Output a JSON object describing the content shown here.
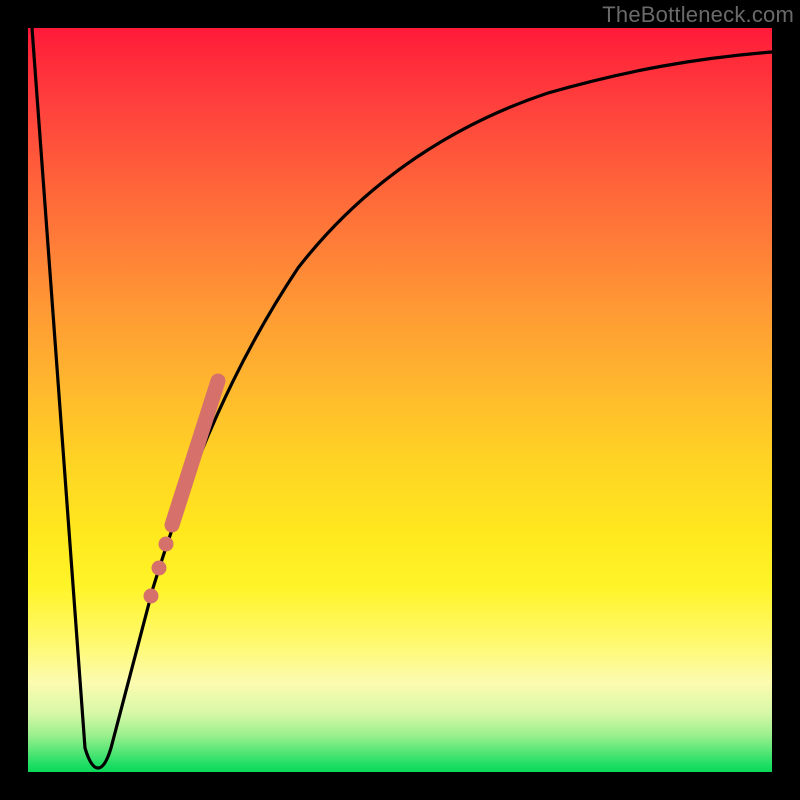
{
  "watermark": "TheBottleneck.com",
  "colors": {
    "frame": "#000000",
    "curve": "#000000",
    "markers": "#d6706a",
    "gradient_top": "#ff1a3a",
    "gradient_bottom": "#0bd95a"
  },
  "chart_data": {
    "type": "line",
    "title": "",
    "xlabel": "",
    "ylabel": "",
    "xlim": [
      0,
      100
    ],
    "ylim": [
      0,
      100
    ],
    "grid": false,
    "legend": false,
    "annotations": [
      "TheBottleneck.com"
    ],
    "series": [
      {
        "name": "bottleneck-curve",
        "x": [
          0,
          2,
          4,
          6,
          7,
          8,
          9,
          10,
          11,
          12,
          14,
          16,
          18,
          20,
          22,
          24,
          27,
          30,
          34,
          38,
          42,
          48,
          55,
          62,
          70,
          78,
          86,
          94,
          100
        ],
        "y": [
          100,
          78,
          55,
          32,
          16,
          3,
          1,
          1,
          3,
          10,
          22,
          32,
          40,
          47,
          52,
          57,
          62,
          67,
          72,
          76,
          80,
          84,
          87,
          89,
          91,
          92,
          93,
          94,
          94.5
        ]
      }
    ],
    "markers": {
      "name": "highlighted-range",
      "style": "thick-dots",
      "points": [
        {
          "x": 16.2,
          "y": 23.0
        },
        {
          "x": 17.3,
          "y": 27.5
        },
        {
          "x": 18.0,
          "y": 30.5
        },
        {
          "x": 19.0,
          "y": 34.0
        },
        {
          "x": 20.5,
          "y": 39.0
        },
        {
          "x": 22.0,
          "y": 44.0
        },
        {
          "x": 23.5,
          "y": 49.0
        },
        {
          "x": 25.0,
          "y": 53.0
        }
      ]
    }
  }
}
